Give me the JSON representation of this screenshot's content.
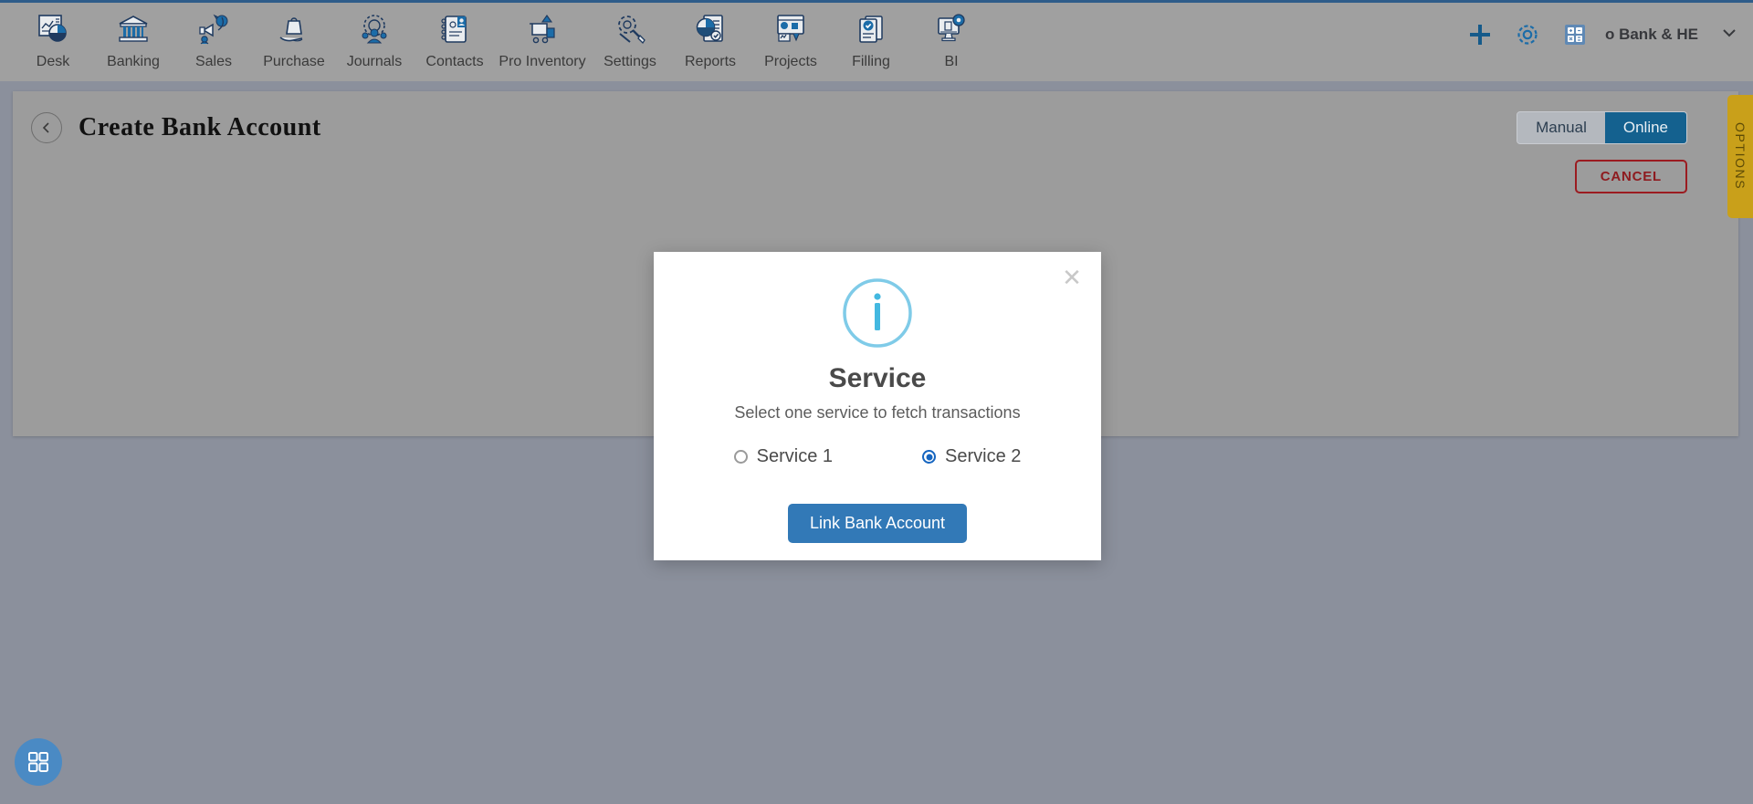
{
  "toolbar": {
    "items": [
      {
        "label": "Desk",
        "icon": "desk-dashboard-icon"
      },
      {
        "label": "Banking",
        "icon": "bank-building-icon"
      },
      {
        "label": "Sales",
        "icon": "sales-megaphone-icon"
      },
      {
        "label": "Purchase",
        "icon": "purchase-bag-hand-icon"
      },
      {
        "label": "Journals",
        "icon": "journals-gear-people-icon"
      },
      {
        "label": "Contacts",
        "icon": "contacts-address-book-icon"
      },
      {
        "label": "Pro Inventory",
        "icon": "inventory-cart-icon"
      },
      {
        "label": "Settings",
        "icon": "settings-gear-wrench-icon"
      },
      {
        "label": "Reports",
        "icon": "reports-piechart-doc-icon"
      },
      {
        "label": "Projects",
        "icon": "projects-board-icon"
      },
      {
        "label": "Filling",
        "icon": "filling-check-doc-icon"
      },
      {
        "label": "BI",
        "icon": "bi-monitor-gear-icon"
      }
    ],
    "right": {
      "add_icon": "plus-icon",
      "settings_icon": "gear-icon",
      "calculator_icon": "calculator-icon",
      "company_name": "o Bank & HE",
      "chevron_icon": "chevron-down-icon"
    }
  },
  "page": {
    "back_icon": "back-chevron-icon",
    "title": "Create Bank Account",
    "mode_toggle": {
      "options": [
        "Manual",
        "Online"
      ],
      "selected": "Online"
    },
    "cancel_label": "CANCEL",
    "options_tab_label": "OPTIONS"
  },
  "modal": {
    "close_icon": "close-icon",
    "info_icon": "info-circle-icon",
    "title": "Service",
    "subtitle": "Select one service to fetch transactions",
    "radios": [
      {
        "label": "Service 1",
        "checked": false
      },
      {
        "label": "Service 2",
        "checked": true
      }
    ],
    "primary_button": "Link Bank Account"
  },
  "fab": {
    "icon": "grid-apps-icon"
  },
  "colors": {
    "accent_blue": "#3279b7",
    "toggle_active": "#14618f",
    "cancel_red": "#8e1b1f",
    "options_gold": "#c9a01a",
    "info_blue": "#76c6e8",
    "radio_blue": "#1565c0",
    "toolbar_bg": "#a0a0a0",
    "page_bg": "#8b909c"
  }
}
